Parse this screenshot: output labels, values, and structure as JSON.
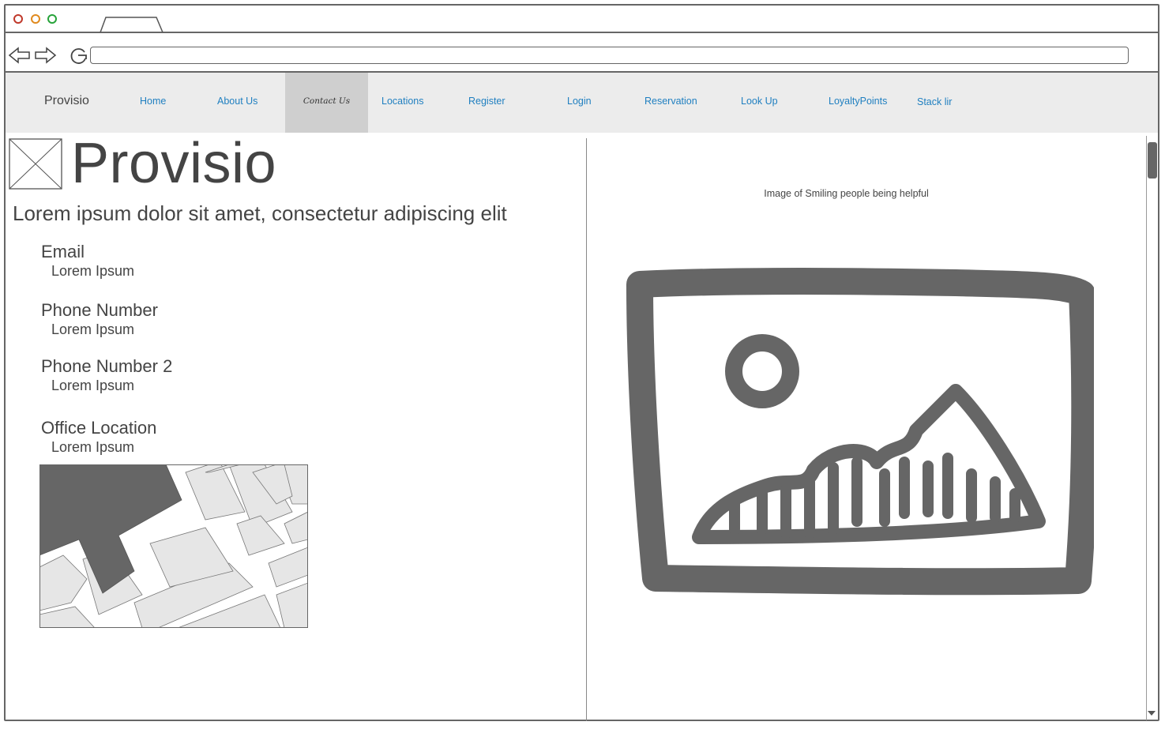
{
  "nav": {
    "brand": "Provisio",
    "items": [
      "Home",
      "About Us",
      "Contact Us",
      "Locations",
      "Register",
      "Login",
      "Reservation",
      "Look Up",
      "LoyaltyPoints",
      "Stack lir"
    ],
    "active": "Contact Us"
  },
  "page": {
    "title": "Provisio",
    "subtitle": "Lorem ipsum dolor sit amet, consectetur adipiscing elit"
  },
  "contact": {
    "email_label": "Email",
    "email_value": "Lorem Ipsum",
    "phone_label": "Phone Number",
    "phone_value": "Lorem Ipsum",
    "phone2_label": "Phone Number 2",
    "phone2_value": "Lorem Ipsum",
    "office_label": "Office Location",
    "office_value": "Lorem Ipsum"
  },
  "image_caption": "Image of Smiling people being helpful",
  "colors": {
    "link": "#1f7fc0",
    "nav_bg": "#ececec",
    "nav_active_bg": "#cfcfcf",
    "close_dot": "#c0392b",
    "min_dot": "#e08a1e",
    "max_dot": "#27a33a"
  },
  "icons": [
    "close-dot",
    "minimize-dot",
    "maximize-dot",
    "back-arrow-icon",
    "forward-arrow-icon",
    "reload-icon",
    "logo-placeholder-icon",
    "map-image",
    "image-placeholder-icon",
    "scrollbar"
  ]
}
